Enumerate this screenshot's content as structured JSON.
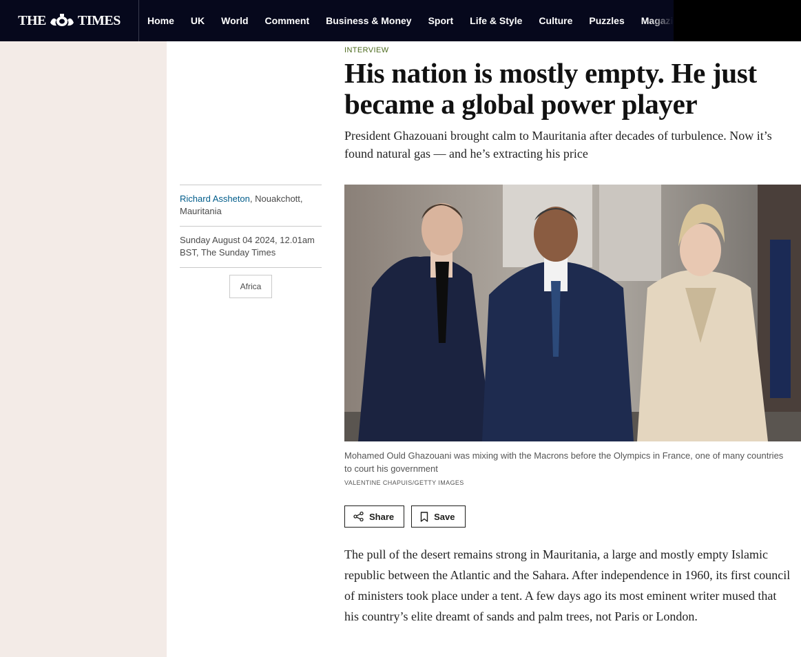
{
  "header": {
    "logo_left": "THE",
    "logo_right": "TIMES",
    "nav": [
      "Home",
      "UK",
      "World",
      "Comment",
      "Business & Money",
      "Sport",
      "Life & Style",
      "Culture",
      "Puzzles",
      "Magazines"
    ]
  },
  "byline": {
    "author": "Richard Assheton",
    "location": ", Nouakchott, Mauritania",
    "date": "Sunday August 04 2024, 12.01am BST, The Sunday Times",
    "tag": "Africa"
  },
  "article": {
    "kicker": "INTERVIEW",
    "headline": "His nation is mostly empty. He just became a global power player",
    "standfirst_line1": "President Ghazouani brought calm to Mauritania after decades of turbulence. Now it’s",
    "standfirst_line2": "found natural gas — and he’s extracting his price",
    "caption": "Mohamed Ould Ghazouani was mixing with the Macrons before the Olympics in France, one of many countries to court his government",
    "credit": "VALENTINE CHAPUIS/GETTY IMAGES",
    "share_label": "Share",
    "save_label": "Save",
    "body": "The pull of the desert remains strong in Mauritania, a large and mostly empty Islamic republic between the Atlantic and the Sahara. After independence in 1960, its first council of ministers took place under a tent. A few days ago its most eminent writer mused that his country’s elite dreamt of sands and palm trees, not Paris or London."
  },
  "colors": {
    "nav_bg": "#06081c",
    "gutter_bg": "#f3ebe7",
    "link": "#005c8a",
    "kicker": "#4d6b1f"
  },
  "icons": [
    "crest-icon",
    "share-icon",
    "bookmark-icon"
  ]
}
